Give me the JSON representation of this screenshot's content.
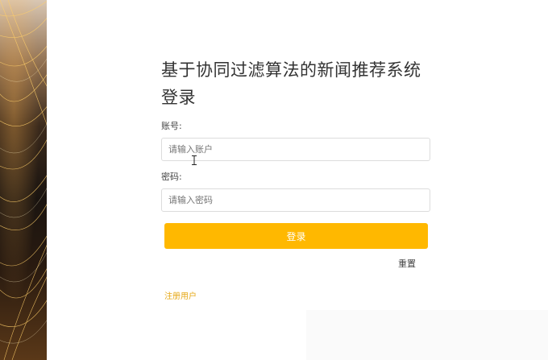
{
  "login": {
    "title": "基于协同过滤算法的新闻推荐系统登录",
    "account_label": "账号:",
    "account_placeholder": "请输入账户",
    "account_value": "",
    "password_label": "密码:",
    "password_placeholder": "请输入密码",
    "password_value": "",
    "login_button": "登录",
    "reset_link": "重置",
    "register_link": "注册用户"
  },
  "colors": {
    "accent": "#ffb800",
    "register_link": "#e6a817",
    "title_text": "#333333"
  },
  "icons": {
    "cursor": "text-cursor-icon"
  }
}
